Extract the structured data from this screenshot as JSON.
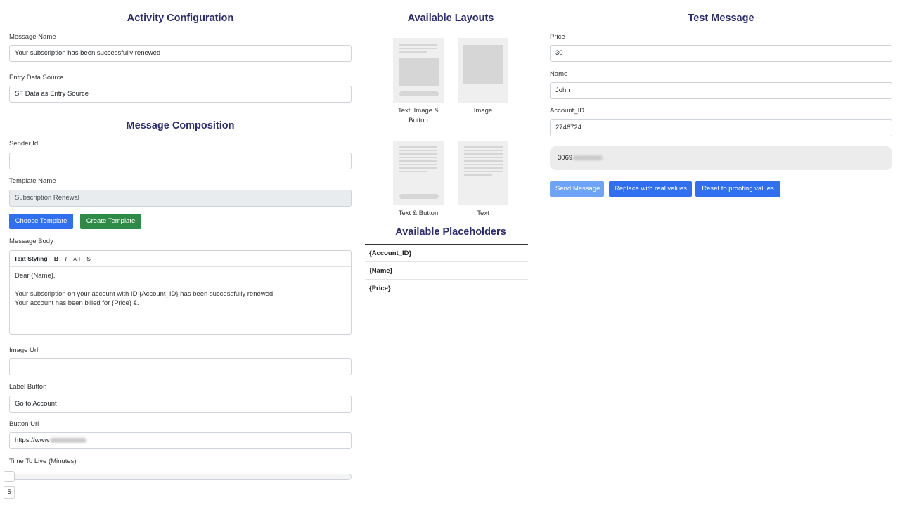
{
  "activity": {
    "heading": "Activity Configuration",
    "message_name_label": "Message Name",
    "message_name_value": "Your subscription has been successfully renewed",
    "entry_source_label": "Entry Data Source",
    "entry_source_value": "SF Data as Entry Source"
  },
  "composition": {
    "heading": "Message Composition",
    "sender_label": "Sender Id",
    "sender_value": "",
    "template_label": "Template Name",
    "template_value": "Subscription Renewal",
    "choose_template": "Choose Template",
    "create_template": "Create Template",
    "body_label": "Message Body",
    "toolbar": {
      "text_styling": "Text Styling",
      "bold": "B",
      "italic": "I",
      "font_size": "AH",
      "strike": "S"
    },
    "body_lines": [
      "Dear {Name},",
      "",
      "Your subscription on your account with ID {Account_ID} has been successfully renewed!",
      "Your account has been billed for {Price} €."
    ],
    "image_url_label": "Image Url",
    "image_url_value": "",
    "label_button_label": "Label Button",
    "label_button_value": "Go to Account",
    "button_url_label": "Button Url",
    "button_url_value": "https://www",
    "ttl_label": "Time To Live (Minutes)",
    "ttl_value": "5"
  },
  "layouts": {
    "heading": "Available Layouts",
    "items": [
      {
        "name": "text-image-button",
        "label_line1": "Text, Image &",
        "label_line2": "Button"
      },
      {
        "name": "image",
        "label_line1": "Image",
        "label_line2": ""
      },
      {
        "name": "text-button",
        "label_line1": "Text & Button",
        "label_line2": ""
      },
      {
        "name": "text",
        "label_line1": "Text",
        "label_line2": ""
      }
    ]
  },
  "placeholders": {
    "heading": "Available Placeholders",
    "items": [
      "{Account_ID}",
      "{Name}",
      "{Price}"
    ]
  },
  "test": {
    "heading": "Test Message",
    "price_label": "Price",
    "price_value": "30",
    "name_label": "Name",
    "name_value": "John",
    "account_label": "Account_ID",
    "account_value": "2746724",
    "phone_value": "3069",
    "send_message": "Send Message",
    "replace_real": "Replace with real values",
    "reset_proofing": "Reset to proofing values"
  },
  "colors": {
    "heading": "#2b2d6e",
    "primary": "#2f6ff0",
    "success": "#2e8b47",
    "disabled_primary": "#6ea4f7"
  }
}
